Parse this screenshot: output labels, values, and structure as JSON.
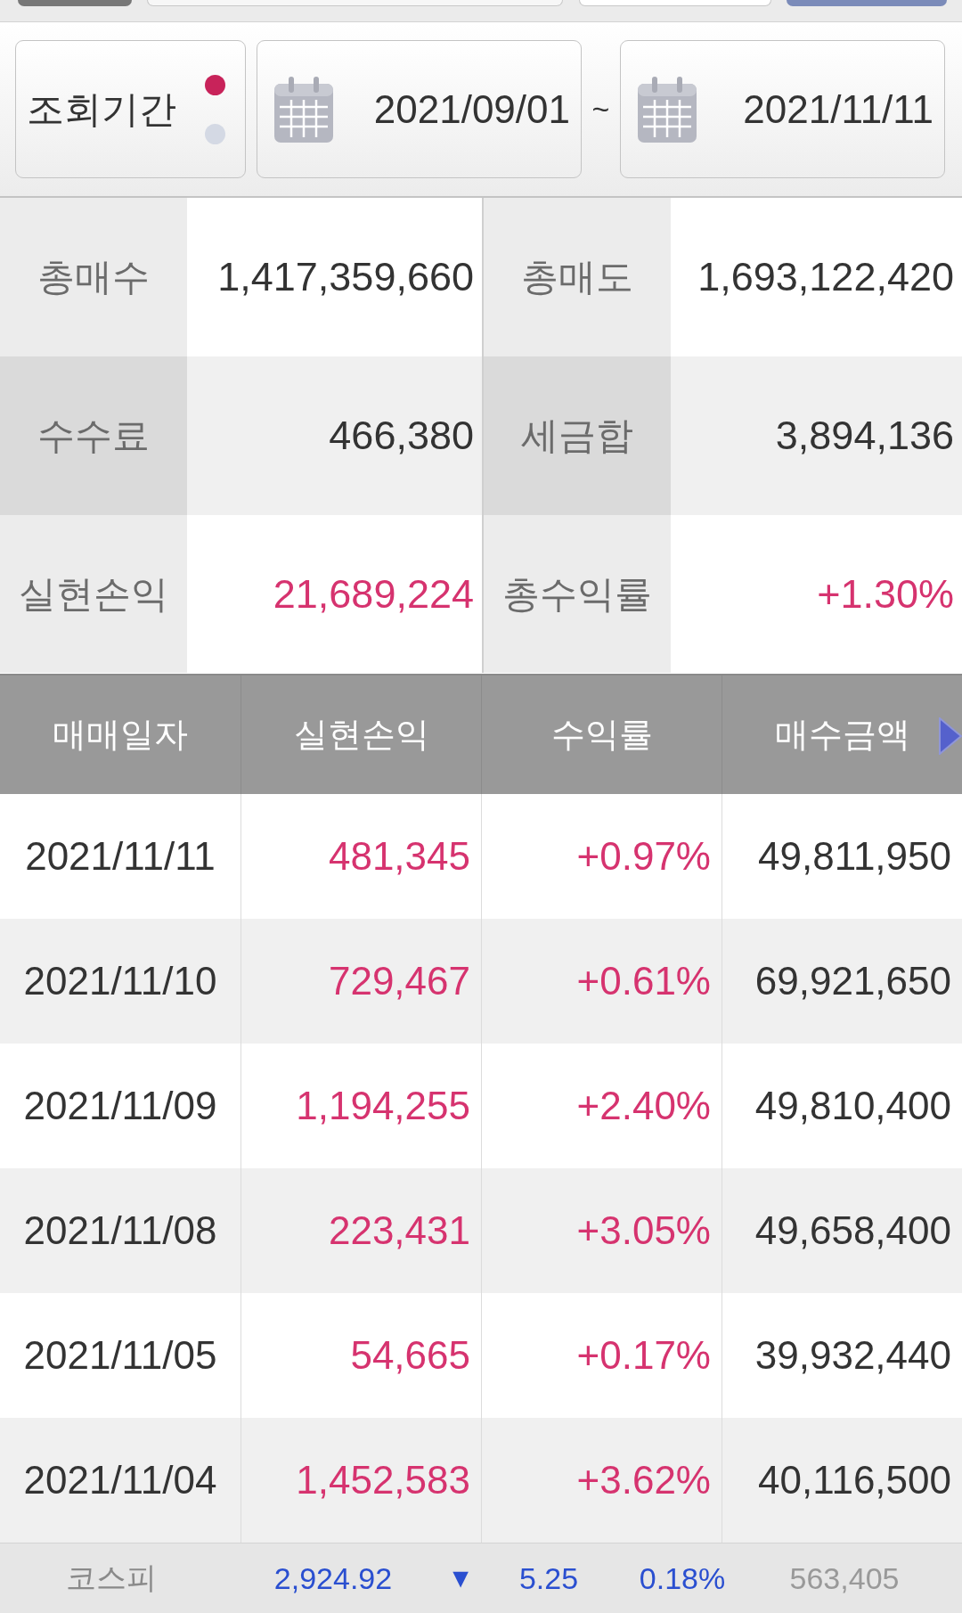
{
  "period": {
    "label": "조회기간",
    "indicator_dots": [
      {
        "selected": true
      },
      {
        "selected": false
      }
    ],
    "start_date": "2021/09/01",
    "separator": "~",
    "end_date": "2021/11/11"
  },
  "summary": {
    "rows": [
      {
        "cells": [
          {
            "label": "총매수",
            "value": "1,417,359,660",
            "kind": "amount"
          },
          {
            "label": "총매도",
            "value": "1,693,122,420",
            "kind": "amount"
          }
        ]
      },
      {
        "cells": [
          {
            "label": "수수료",
            "value": "466,380",
            "kind": "amount"
          },
          {
            "label": "세금합",
            "value": "3,894,136",
            "kind": "amount"
          }
        ]
      },
      {
        "cells": [
          {
            "label": "실현손익",
            "value": "21,689,224",
            "kind": "profit"
          },
          {
            "label": "총수익률",
            "value": "+1.30%",
            "kind": "profit"
          }
        ]
      }
    ]
  },
  "table": {
    "columns": [
      "매매일자",
      "실현손익",
      "수익률",
      "매수금액"
    ],
    "rows": [
      {
        "date": "2021/11/11",
        "profit": "481,345",
        "rate": "+0.97%",
        "buy_amount": "49,811,950",
        "up": true
      },
      {
        "date": "2021/11/10",
        "profit": "729,467",
        "rate": "+0.61%",
        "buy_amount": "69,921,650",
        "up": true
      },
      {
        "date": "2021/11/09",
        "profit": "1,194,255",
        "rate": "+2.40%",
        "buy_amount": "49,810,400",
        "up": true
      },
      {
        "date": "2021/11/08",
        "profit": "223,431",
        "rate": "+3.05%",
        "buy_amount": "49,658,400",
        "up": true
      },
      {
        "date": "2021/11/05",
        "profit": "54,665",
        "rate": "+0.17%",
        "buy_amount": "39,932,440",
        "up": true
      },
      {
        "date": "2021/11/04",
        "profit": "1,452,583",
        "rate": "+3.62%",
        "buy_amount": "40,116,500",
        "up": true
      }
    ]
  },
  "ticker": {
    "name": "코스피",
    "index": "2,924.92",
    "arrow": "▼",
    "change": "5.25",
    "change_rate": "0.18%",
    "volume": "563,405",
    "up": false
  }
}
